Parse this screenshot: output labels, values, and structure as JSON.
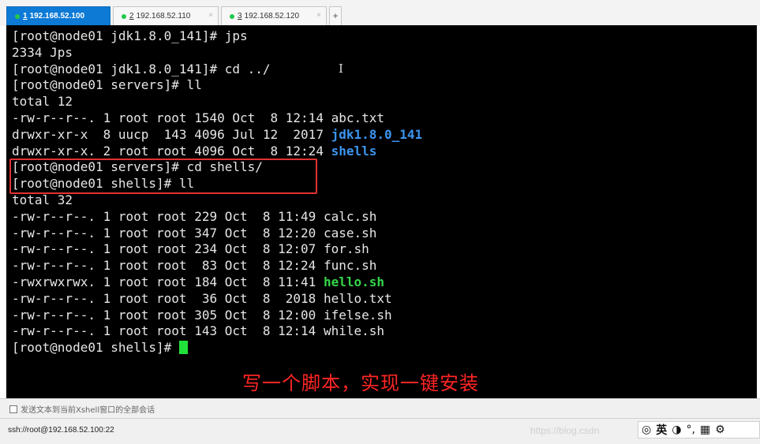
{
  "tabs": [
    {
      "num": "1",
      "host": "192.168.52.100",
      "active": true
    },
    {
      "num": "2",
      "host": "192.168.52.110",
      "active": false
    },
    {
      "num": "3",
      "host": "192.168.52.120",
      "active": false
    }
  ],
  "tab_add_label": "+",
  "tab_close_label": "×",
  "terminal": {
    "lines": [
      {
        "text": "[root@node01 jdk1.8.0_141]# jps"
      },
      {
        "text": "2334 Jps"
      },
      {
        "text": "[root@node01 jdk1.8.0_141]# cd ../"
      },
      {
        "text": "[root@node01 servers]# ll"
      },
      {
        "text": "total 12"
      },
      {
        "text": "-rw-r--r--. 1 root root 1540 Oct  8 12:14 abc.txt"
      },
      {
        "text": "drwxr-xr-x  8 uucp  143 4096 Jul 12  2017 ",
        "hl": "jdk1.8.0_141",
        "hl_type": "dir"
      },
      {
        "text": "drwxr-xr-x. 2 root root 4096 Oct  8 12:24 ",
        "hl": "shells",
        "hl_type": "dir"
      },
      {
        "text": "[root@node01 servers]# cd shells/"
      },
      {
        "text": "[root@node01 shells]# ll"
      },
      {
        "text": "total 32"
      },
      {
        "text": "-rw-r--r--. 1 root root 229 Oct  8 11:49 calc.sh"
      },
      {
        "text": "-rw-r--r--. 1 root root 347 Oct  8 12:20 case.sh"
      },
      {
        "text": "-rw-r--r--. 1 root root 234 Oct  8 12:07 for.sh"
      },
      {
        "text": "-rw-r--r--. 1 root root  83 Oct  8 12:24 func.sh"
      },
      {
        "text": "-rwxrwxrwx. 1 root root 184 Oct  8 11:41 ",
        "hl": "hello.sh",
        "hl_type": "exec"
      },
      {
        "text": "-rw-r--r--. 1 root root  36 Oct  8  2018 hello.txt"
      },
      {
        "text": "-rw-r--r--. 1 root root 305 Oct  8 12:00 ifelse.sh"
      },
      {
        "text": "-rw-r--r--. 1 root root 143 Oct  8 12:14 while.sh"
      },
      {
        "text": "[root@node01 shells]# ",
        "cursor": true
      }
    ],
    "annotation": "写一个脚本，实现一键安装",
    "text_cursor_glyph": "I"
  },
  "compose_bar": {
    "text": "发送文本到当前Xshell窗口的全部会话"
  },
  "status_bar": {
    "connection": "ssh://root@192.168.52.100:22",
    "watermark": "https://blog.csdn",
    "ime": {
      "icon1": "◎",
      "mode": "英",
      "icon2": "◑",
      "icon3": "°,",
      "icon4": "▦",
      "icon5": "⚙"
    }
  },
  "colors": {
    "terminal_bg": "#000000",
    "terminal_fg": "#e6e6e6",
    "dir_color": "#3c95ef",
    "exec_color": "#34d64a",
    "annotation_color": "#ff2525",
    "active_tab": "#0d7ad6",
    "highlight_box": "#e23232"
  }
}
